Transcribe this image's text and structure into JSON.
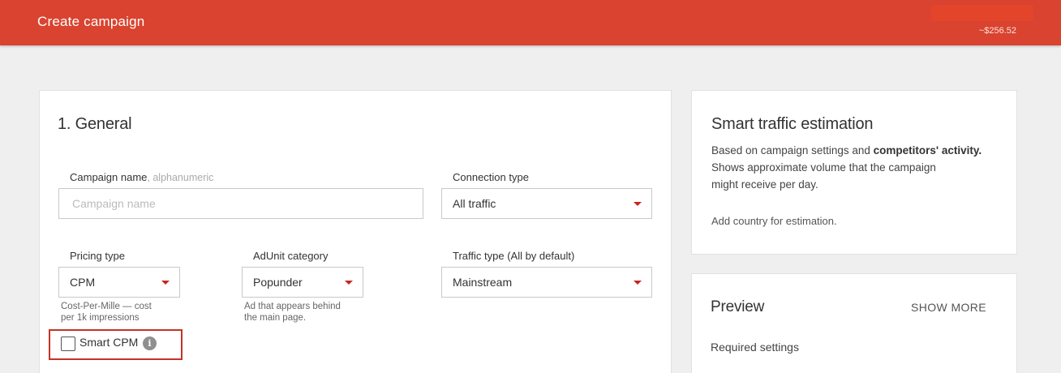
{
  "header": {
    "title": "Create campaign",
    "balance": "~$256.52",
    "accent_color": "#d9432f"
  },
  "general": {
    "section_title": "1. General",
    "campaign_name": {
      "label": "Campaign name",
      "hint": ", alphanumeric",
      "placeholder": "Campaign name",
      "value": ""
    },
    "connection_type": {
      "label": "Connection type",
      "value": "All traffic"
    },
    "pricing_type": {
      "label": "Pricing type",
      "value": "CPM",
      "help_line1": "Cost-Per-Mille — cost",
      "help_line2": "per 1k impressions"
    },
    "adunit_category": {
      "label": "AdUnit category",
      "value": "Popunder",
      "help_line1": "Ad that appears behind",
      "help_line2": "the main page."
    },
    "traffic_type": {
      "label": "Traffic type (All by default)",
      "value": "Mainstream"
    },
    "smart_cpm": {
      "label": "Smart CPM",
      "checked": false,
      "info_glyph": "i"
    }
  },
  "estimation": {
    "title": "Smart traffic estimation",
    "text_prefix": "Based on campaign settings and ",
    "text_bold": "competitors' activity.",
    "line2": "Shows approximate volume that the campaign",
    "line3": "might receive per day.",
    "note": "Add country for estimation."
  },
  "preview": {
    "title": "Preview",
    "show_more": "SHOW MORE",
    "required": "Required settings"
  }
}
